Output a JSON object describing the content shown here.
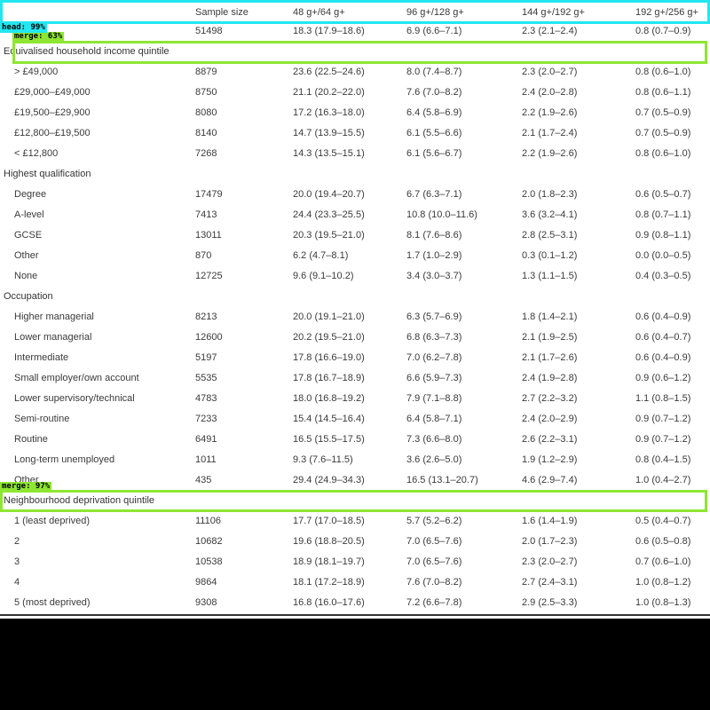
{
  "table": {
    "columns": [
      "Sample size",
      "48 g+/64 g+",
      "96 g+/128 g+",
      "144 g+/192 g+",
      "192 g+/256 g+"
    ],
    "total_row": [
      "",
      "51498",
      "18.3 (17.9–18.6)",
      "6.9 (6.6–7.1)",
      "2.3 (2.1–2.4)",
      "0.8 (0.7–0.9)"
    ],
    "sections": [
      {
        "title": "Equivalised household income quintile",
        "rows": [
          [
            "> £49,000",
            "8879",
            "23.6 (22.5–24.6)",
            "8.0 (7.4–8.7)",
            "2.3 (2.0–2.7)",
            "0.8 (0.6–1.0)"
          ],
          [
            "£29,000–£49,000",
            "8750",
            "21.1 (20.2–22.0)",
            "7.6 (7.0–8.2)",
            "2.4 (2.0–2.8)",
            "0.8 (0.6–1.1)"
          ],
          [
            "£19,500–£29,900",
            "8080",
            "17.2 (16.3–18.0)",
            "6.4 (5.8–6.9)",
            "2.2 (1.9–2.6)",
            "0.7 (0.5–0.9)"
          ],
          [
            "£12,800–£19,500",
            "8140",
            "14.7 (13.9–15.5)",
            "6.1 (5.5–6.6)",
            "2.1 (1.7–2.4)",
            "0.7 (0.5–0.9)"
          ],
          [
            "< £12,800",
            "7268",
            "14.3 (13.5–15.1)",
            "6.1 (5.6–6.7)",
            "2.2 (1.9–2.6)",
            "0.8 (0.6–1.0)"
          ]
        ]
      },
      {
        "title": "Highest qualification",
        "rows": [
          [
            "Degree",
            "17479",
            "20.0 (19.4–20.7)",
            "6.7 (6.3–7.1)",
            "2.0 (1.8–2.3)",
            "0.6 (0.5–0.7)"
          ],
          [
            "A-level",
            "7413",
            "24.4 (23.3–25.5)",
            "10.8 (10.0–11.6)",
            "3.6 (3.2–4.1)",
            "0.8 (0.7–1.1)"
          ],
          [
            "GCSE",
            "13011",
            "20.3 (19.5–21.0)",
            "8.1 (7.6–8.6)",
            "2.8 (2.5–3.1)",
            "0.9 (0.8–1.1)"
          ],
          [
            "Other",
            "870",
            "6.2 (4.7–8.1)",
            "1.7 (1.0–2.9)",
            "0.3 (0.1–1.2)",
            "0.0 (0.0–0.5)"
          ],
          [
            "None",
            "12725",
            "9.6 (9.1–10.2)",
            "3.4 (3.0–3.7)",
            "1.3 (1.1–1.5)",
            "0.4 (0.3–0.5)"
          ]
        ]
      },
      {
        "title": "Occupation",
        "rows": [
          [
            "Higher managerial",
            "8213",
            "20.0 (19.1–21.0)",
            "6.3 (5.7–6.9)",
            "1.8 (1.4–2.1)",
            "0.6 (0.4–0.9)"
          ],
          [
            "Lower managerial",
            "12600",
            "20.2 (19.5–21.0)",
            "6.8 (6.3–7.3)",
            "2.1 (1.9–2.5)",
            "0.6 (0.4–0.7)"
          ],
          [
            "Intermediate",
            "5197",
            "17.8 (16.6–19.0)",
            "7.0 (6.2–7.8)",
            "2.1 (1.7–2.6)",
            "0.6 (0.4–0.9)"
          ],
          [
            "Small employer/own account",
            "5535",
            "17.8 (16.7–18.9)",
            "6.6 (5.9–7.3)",
            "2.4 (1.9–2.8)",
            "0.9 (0.6–1.2)"
          ],
          [
            "Lower supervisory/technical",
            "4783",
            "18.0 (16.8–19.2)",
            "7.9 (7.1–8.8)",
            "2.7 (2.2–3.2)",
            "1.1 (0.8–1.5)"
          ],
          [
            "Semi-routine",
            "7233",
            "15.4 (14.5–16.4)",
            "6.4 (5.8–7.1)",
            "2.4 (2.0–2.9)",
            "0.9 (0.7–1.2)"
          ],
          [
            "Routine",
            "6491",
            "16.5 (15.5–17.5)",
            "7.3 (6.6–8.0)",
            "2.6 (2.2–3.1)",
            "0.9 (0.7–1.2)"
          ],
          [
            "Long-term unemployed",
            "1011",
            "9.3 (7.6–11.5)",
            "3.6 (2.6–5.0)",
            "1.9 (1.2–2.9)",
            "0.8 (0.4–1.5)"
          ],
          [
            "Other",
            "435",
            "29.4 (24.9–34.3)",
            "16.5 (13.1–20.7)",
            "4.6 (2.9–7.4)",
            "1.0 (0.4–2.7)"
          ]
        ]
      },
      {
        "title": "Neighbourhood deprivation quintile",
        "rows": [
          [
            "1 (least deprived)",
            "11106",
            "17.7 (17.0–18.5)",
            "5.7 (5.2–6.2)",
            "1.6 (1.4–1.9)",
            "0.5 (0.4–0.7)"
          ],
          [
            "2",
            "10682",
            "19.6 (18.8–20.5)",
            "7.0 (6.5–7.6)",
            "2.0 (1.7–2.3)",
            "0.6 (0.5–0.8)"
          ],
          [
            "3",
            "10538",
            "18.9 (18.1–19.7)",
            "7.0 (6.5–7.6)",
            "2.3 (2.0–2.7)",
            "0.7 (0.6–1.0)"
          ],
          [
            "4",
            "9864",
            "18.1 (17.2–18.9)",
            "7.6 (7.0–8.2)",
            "2.7 (2.4–3.1)",
            "1.0 (0.8–1.2)"
          ],
          [
            "5 (most deprived)",
            "9308",
            "16.8 (16.0–17.6)",
            "7.2 (6.6–7.8)",
            "2.9 (2.5–3.3)",
            "1.0 (0.8–1.3)"
          ]
        ]
      }
    ]
  },
  "detections": [
    {
      "label": "head: 99%",
      "color": "#22e6f0"
    },
    {
      "label": "merge: 63%",
      "color": "#8ee632"
    },
    {
      "label": "merge: 97%",
      "color": "#8ee632"
    }
  ]
}
